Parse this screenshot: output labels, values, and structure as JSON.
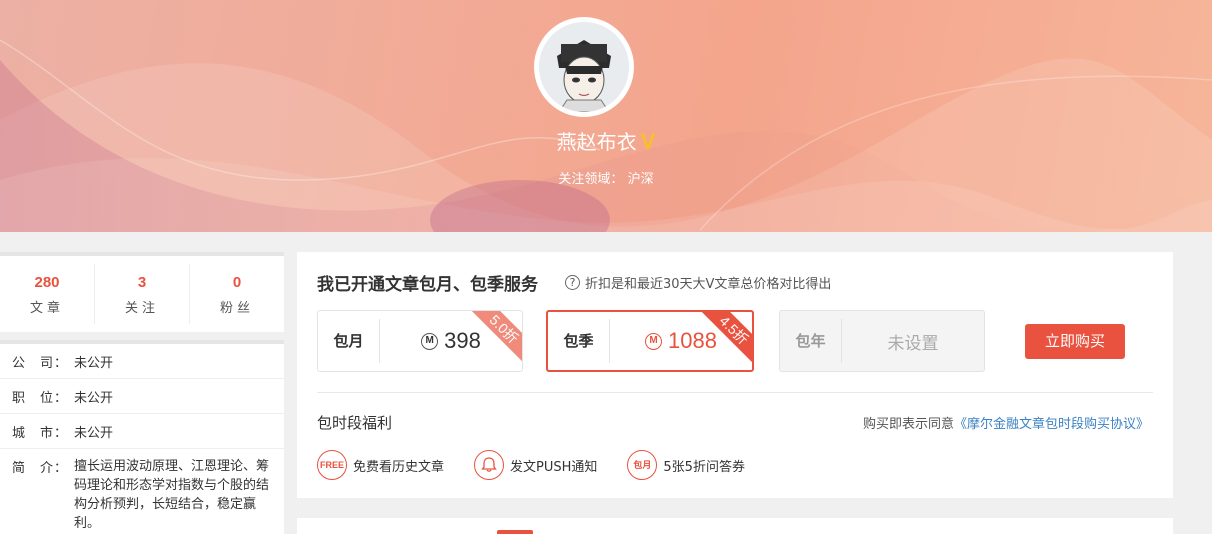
{
  "profile": {
    "name": "燕赵布衣",
    "verified_badge": "V",
    "focus_label": "关注领域：",
    "focus_value": "沪深"
  },
  "stats": [
    {
      "num": "280",
      "label": "文章"
    },
    {
      "num": "3",
      "label": "关注"
    },
    {
      "num": "0",
      "label": "粉丝"
    }
  ],
  "info": {
    "company": {
      "key": "公　司：",
      "value": "未公开"
    },
    "position": {
      "key": "职　位：",
      "value": "未公开"
    },
    "city": {
      "key": "城　市：",
      "value": "未公开"
    },
    "intro": {
      "key": "简　介：",
      "value": "擅长运用波动原理、江恩理论、筹码理论和形态学对指数与个股的结构分析预判，长短结合，稳定赢利。"
    }
  },
  "service": {
    "title": "我已开通文章包月、包季服务",
    "hint": "折扣是和最近30天大V文章总价格对比得出",
    "hint_icon": "?",
    "coin_icon": "M",
    "plans": [
      {
        "name": "包月",
        "price": "398",
        "discount": "5.0折"
      },
      {
        "name": "包季",
        "price": "1088",
        "discount": "4.5折"
      },
      {
        "name": "包年",
        "price": "未设置"
      }
    ],
    "buy_label": "立即购买"
  },
  "benefits": {
    "title": "包时段福利",
    "agreement_prefix": "购买即表示同意",
    "agreement_link": "《摩尔金融文章包时段购买协议》",
    "items": [
      {
        "icon": "FREE",
        "label": "免费看历史文章"
      },
      {
        "icon": "🔔",
        "label": "发文PUSH通知"
      },
      {
        "icon": "包月",
        "label": "5张5折问答券"
      }
    ]
  },
  "colors": {
    "accent": "#e8523e",
    "link": "#3b82c4",
    "verified": "#f7c12a"
  }
}
